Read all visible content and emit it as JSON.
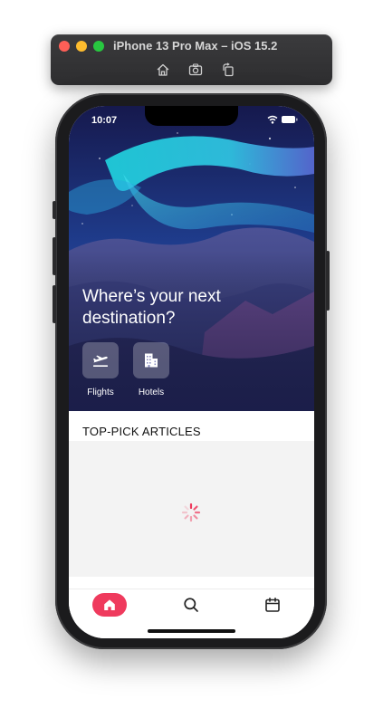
{
  "simulator": {
    "title": "iPhone 13 Pro Max – iOS 15.2",
    "tools": [
      "home-icon",
      "screenshot-icon",
      "rotate-icon"
    ]
  },
  "status_bar": {
    "time": "10:07"
  },
  "hero": {
    "headline_line1": "Where’s your next",
    "headline_line2": "destination?",
    "categories": [
      {
        "label": "Flights",
        "icon": "airplane-departure-icon"
      },
      {
        "label": "Hotels",
        "icon": "hotel-building-icon"
      }
    ]
  },
  "articles": {
    "section_title": "TOP-PICK ARTICLES",
    "loading": true
  },
  "tab_bar": {
    "items": [
      {
        "icon": "home-icon",
        "active": true
      },
      {
        "icon": "search-icon",
        "active": false
      },
      {
        "icon": "calendar-icon",
        "active": false
      }
    ],
    "active_color": "#ef3a5d"
  }
}
